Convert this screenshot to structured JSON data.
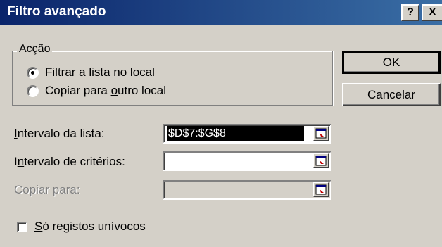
{
  "window": {
    "title": "Filtro avançado",
    "help_label": "?",
    "close_label": "X"
  },
  "action_group": {
    "label": "Acção",
    "options": [
      {
        "pre": "",
        "key": "F",
        "post": "iltrar a lista no local",
        "selected": true
      },
      {
        "pre": "Copiar para ",
        "key": "o",
        "post": "utro local",
        "selected": false
      }
    ]
  },
  "buttons": {
    "ok": "OK",
    "cancel": "Cancelar"
  },
  "fields": {
    "list_range": {
      "key": "I",
      "post": "ntervalo da lista:",
      "value": "$D$7:$G$8"
    },
    "criteria_range": {
      "pre": "I",
      "key": "n",
      "post": "tervalo de critérios:",
      "value": ""
    },
    "copy_to": {
      "label": "Copiar para:",
      "value": ""
    }
  },
  "unique_records": {
    "key": "S",
    "post": "ó registos unívocos",
    "checked": false
  },
  "icons": [
    "collapse-dialog-icon"
  ]
}
